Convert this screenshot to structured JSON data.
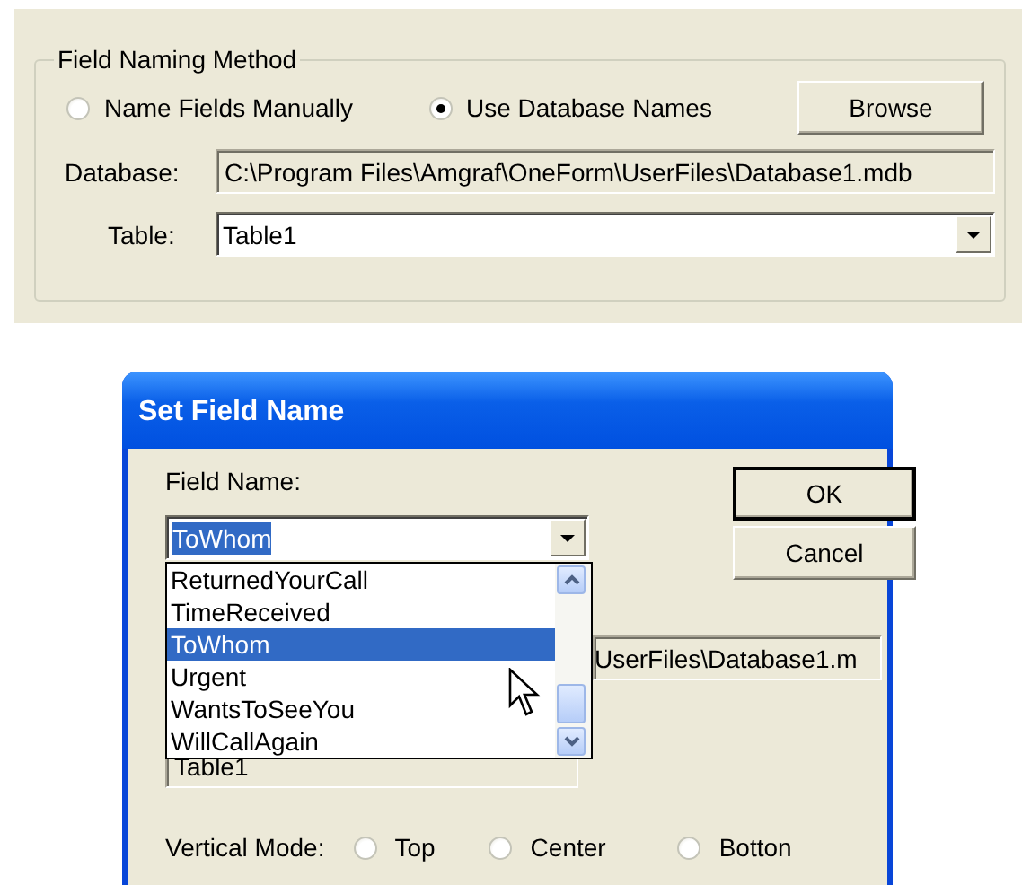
{
  "panel": {
    "group_title": "Field Naming Method",
    "radios": [
      {
        "label": "Name Fields Manually",
        "selected": false
      },
      {
        "label": "Use Database Names",
        "selected": true
      }
    ],
    "browse_button": "Browse",
    "database": {
      "label": "Database:",
      "value": "C:\\Program Files\\Amgraf\\OneForm\\UserFiles\\Database1.mdb"
    },
    "table": {
      "label": "Table:",
      "value": "Table1"
    }
  },
  "dialog": {
    "title": "Set Field Name",
    "field_name": {
      "label": "Field Name:",
      "value": "ToWhom",
      "text_selected": true
    },
    "buttons": [
      "OK",
      "Cancel"
    ],
    "dropdown": {
      "items": [
        {
          "label": "ReturnedYourCall",
          "selected": false
        },
        {
          "label": "TimeReceived",
          "selected": false
        },
        {
          "label": "ToWhom",
          "selected": true
        },
        {
          "label": "Urgent",
          "selected": false
        },
        {
          "label": "WantsToSeeYou",
          "selected": false
        },
        {
          "label": "WillCallAgain",
          "selected": false
        }
      ]
    },
    "database_value": "UserFiles\\Database1.m",
    "table_value": "Table1",
    "vertical_mode": {
      "label": "Vertical Mode:",
      "options": [
        {
          "label": "Top",
          "selected": false
        },
        {
          "label": "Center",
          "selected": false
        },
        {
          "label": "Botton",
          "selected": false
        }
      ]
    }
  }
}
